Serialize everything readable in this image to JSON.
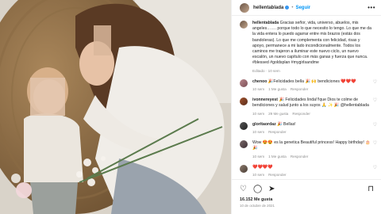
{
  "header": {
    "username": "hellentablada",
    "separator": "•",
    "follow_label": "Seguir",
    "more_icon": "more-horizontal-icon"
  },
  "caption": {
    "username": "hellentablada",
    "text": "Gracias señor, vida, universo, abuelos, mis angeles……. porque todo lo que necesito lo tengo. Lo que me da la vida entera lo puedo agarrar entre mis brazos (estás dos bandoleras). Lo que me complementa con felicidad, risas y apoyo, permanece a mi lado incondicionalmente. Todos los caminos me trajeron a iluminar este nuevo ciclo, un nuevo escalón, un nuevo capítulo con más ganas y fuerza que nunca. #blessed #goldsplan #mygirlsandme",
    "edited": "Editado · 10 sem"
  },
  "comments": [
    {
      "username": "chenoo",
      "text": "🎉Felicidades bella 🎉 🙌 bendiciones ❤️❤️❤️",
      "time": "10 sem",
      "likes": "1 Me gusta",
      "reply": "Responder"
    },
    {
      "username": "ivonnereyest",
      "text": "🎉 Felicidades linda!!!que Dios te colme de bendiciones y salud junto a los suyos 🙏 ✨ 🎉 @hellentablada",
      "time": "10 sem",
      "likes": "29 Me gusta",
      "reply": "Responder"
    },
    {
      "username": "gloritaordaz",
      "text": "🎉 Bellas!",
      "time": "10 sem",
      "likes": "",
      "reply": "Responder"
    },
    {
      "username": "",
      "text": "Wow 😍😍 es la genetica Beautiful princess! Happy birthday! 🎂 🎉",
      "time": "10 sem",
      "likes": "1 Me gusta",
      "reply": "Responder"
    },
    {
      "username": "",
      "text": "❤️❤️❤️❤️",
      "time": "10 sem",
      "likes": "",
      "reply": "Responder"
    }
  ],
  "actions": {
    "like_icon": "heart-outline-icon",
    "comment_icon": "comment-icon",
    "share_icon": "paper-plane-icon",
    "save_icon": "bookmark-icon",
    "likes_count": "16.152 Me gusta",
    "date": "10 de octubre de 2021"
  }
}
